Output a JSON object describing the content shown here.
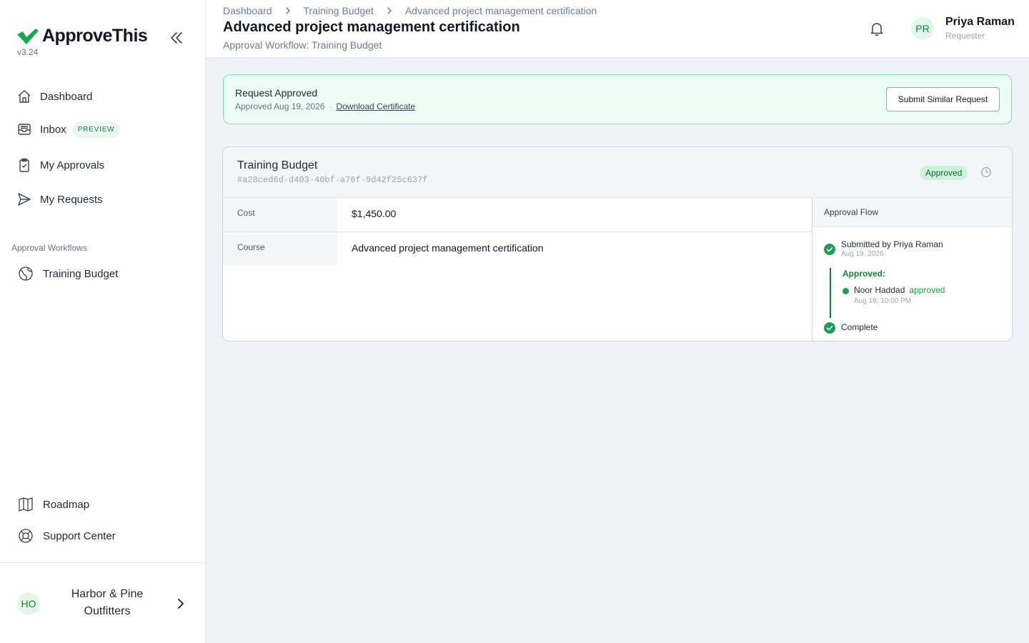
{
  "app": {
    "name": "ApproveThis",
    "version": "v3.24"
  },
  "sidebar": {
    "nav": [
      {
        "label": "Dashboard",
        "icon": "home-icon"
      },
      {
        "label": "Inbox",
        "icon": "inbox-icon",
        "badge": "PREVIEW"
      },
      {
        "label": "My Approvals",
        "icon": "clipboard-check-icon"
      },
      {
        "label": "My Requests",
        "icon": "send-icon"
      }
    ],
    "workflows_label": "Approval Workflows",
    "workflows": [
      {
        "label": "Training Budget",
        "icon": "globe-icon"
      }
    ],
    "bottom": [
      {
        "label": "Roadmap",
        "icon": "map-icon"
      },
      {
        "label": "Support Center",
        "icon": "lifebuoy-icon"
      }
    ],
    "org": {
      "initials": "HO",
      "name": "Harbor & Pine Outfitters"
    }
  },
  "header": {
    "breadcrumb": [
      "Dashboard",
      "Training Budget",
      "Advanced project management certification"
    ],
    "title": "Advanced project management certification",
    "subtitle": "Approval Workflow: Training Budget",
    "user": {
      "initials": "PR",
      "name": "Priya Raman",
      "role": "Requester"
    }
  },
  "banner": {
    "title": "Request Approved",
    "date_text": "Approved Aug 19, 2026",
    "separator": "·",
    "link": "Download Certificate",
    "button": "Submit Similar Request"
  },
  "request": {
    "title": "Training Budget",
    "id": "#a28ced6d-d403-40bf-a76f-9d42f25c637f",
    "status": "Approved",
    "fields": [
      {
        "label": "Cost",
        "value": "$1,450.00"
      },
      {
        "label": "Course",
        "value": "Advanced project management certification"
      }
    ]
  },
  "flow": {
    "title": "Approval Flow",
    "submitted": {
      "text": "Submitted by Priya Raman",
      "date": "Aug 19, 2026"
    },
    "approved_label": "Approved:",
    "approver": {
      "name": "Noor Haddad",
      "status": "approved",
      "date": "Aug 19, 10:00 PM"
    },
    "complete": "Complete"
  },
  "colors": {
    "brand_green": "#15803d",
    "success_bg": "#ecfdf5",
    "success_border": "#86dcb0",
    "page_bg": "#eff3f8"
  }
}
